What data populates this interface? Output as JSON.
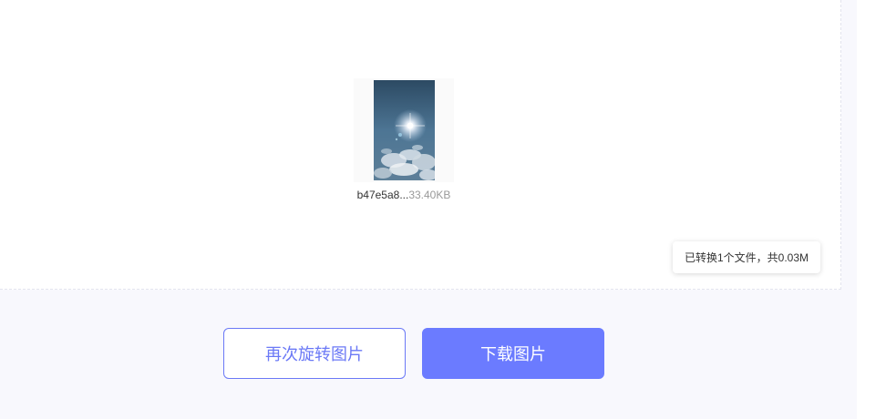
{
  "file": {
    "name": "b47e5a8...",
    "size": "33.40KB"
  },
  "summary": {
    "text": "已转换1个文件，共0.03M"
  },
  "actions": {
    "rotate_again_label": "再次旋转图片",
    "download_label": "下载图片"
  },
  "colors": {
    "accent": "#6b7bff",
    "page_background": "#f8f8fd"
  }
}
